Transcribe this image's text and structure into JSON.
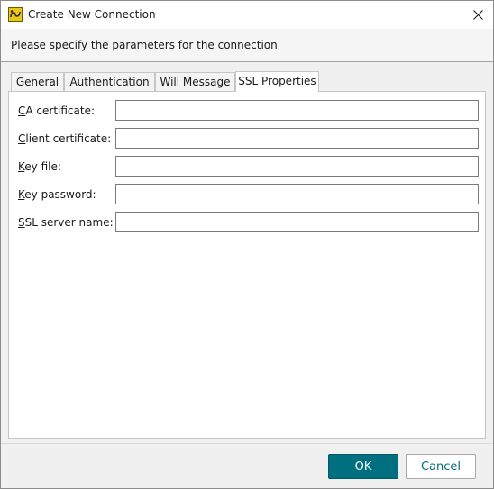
{
  "window": {
    "title": "Create New Connection",
    "description": "Please specify the parameters for the connection"
  },
  "tabs": [
    {
      "label": "General"
    },
    {
      "label": "Authentication"
    },
    {
      "label": "Will Message"
    },
    {
      "label": "SSL Properties",
      "active": true
    }
  ],
  "form": {
    "fields": [
      {
        "mnemonic": "C",
        "label_rest": "A certificate:",
        "value": ""
      },
      {
        "mnemonic": "C",
        "label_rest": "lient certificate:",
        "value": ""
      },
      {
        "mnemonic": "K",
        "label_rest": "ey file:",
        "value": ""
      },
      {
        "mnemonic": "K",
        "label_rest": "ey password:",
        "value": ""
      },
      {
        "mnemonic": "S",
        "label_rest": "SL server name:",
        "value": ""
      }
    ]
  },
  "footer": {
    "ok_label": "OK",
    "cancel_label": "Cancel"
  },
  "colors": {
    "accent": "#007080",
    "app_icon": "#e8c61a"
  },
  "icons": {
    "app": "app-logo-icon",
    "close": "close-icon"
  }
}
